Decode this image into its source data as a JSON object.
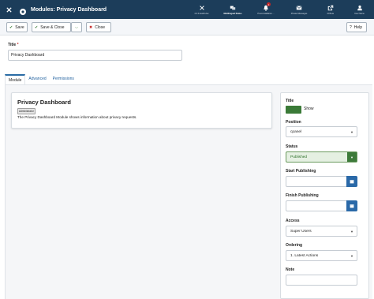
{
  "header": {
    "page_title": "Modules: Privacy Dashboard",
    "items": [
      {
        "label": "4.0.0-beta5-dev",
        "icon": "joomla-icon"
      },
      {
        "label": "Multilingual Status",
        "icon": "language-icon"
      },
      {
        "label": "Post-installation ...",
        "icon": "bell-icon",
        "badge": "1"
      },
      {
        "label": "Private Messages",
        "icon": "envelope-icon"
      },
      {
        "label": "J4 Beta",
        "icon": "external-link-icon"
      },
      {
        "label": "User Menu",
        "icon": "user-icon"
      }
    ]
  },
  "toolbar": {
    "save": "Save",
    "save_close": "Save & Close",
    "close": "Close",
    "help": "Help"
  },
  "form": {
    "title_label": "Title",
    "required_marker": "*",
    "title_value": "Privacy Dashboard"
  },
  "tabs": [
    "Module",
    "Advanced",
    "Permissions"
  ],
  "module": {
    "title": "Privacy Dashboard",
    "badge": "Administrator",
    "description": "The Privacy Dashboard Module shows information about privacy requests."
  },
  "sidebar": {
    "title_label": "Title",
    "show_label": "Show",
    "position_label": "Position",
    "position_value": "cpanel",
    "status_label": "Status",
    "status_value": "Published",
    "start_label": "Start Publishing",
    "finish_label": "Finish Publishing",
    "access_label": "Access",
    "access_value": "Super Users",
    "ordering_label": "Ordering",
    "ordering_value": "1. Latest Actions",
    "note_label": "Note"
  },
  "colors": {
    "header_bg": "#1c3d5a",
    "status_green": "#3d7a3a",
    "calendar_blue": "#2a69a8",
    "close_red": "#c52827"
  }
}
